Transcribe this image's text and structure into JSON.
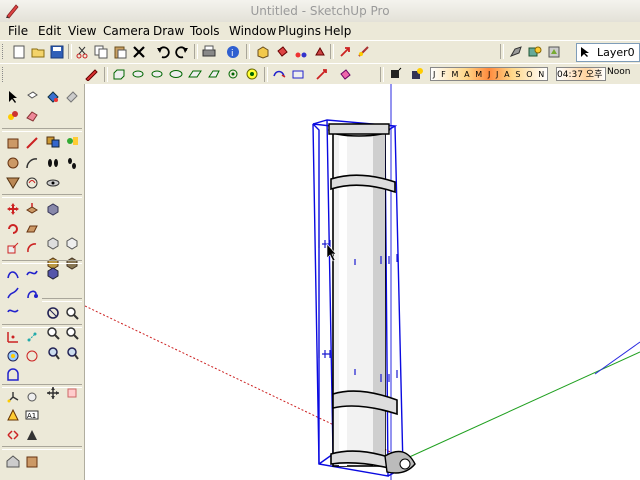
{
  "window": {
    "title": "Untitled - SketchUp Pro"
  },
  "menu": [
    "File",
    "Edit",
    "View",
    "Camera",
    "Draw",
    "Tools",
    "Window",
    "Plugins",
    "Help"
  ],
  "layers": {
    "current": "Layer0"
  },
  "shadows": {
    "months": "J F M A M J J A S O N D",
    "time": "04:37 오후",
    "noon": "Noon"
  },
  "toolbar1": [
    "new-icon",
    "open-icon",
    "save-icon",
    "cut-icon",
    "copy-icon",
    "paste-icon",
    "erase-icon",
    "undo-icon",
    "redo-icon",
    "print-icon",
    "model-info-icon",
    "make-component-icon",
    "paint-bucket-icon",
    "scissors-icon",
    "move-icon",
    "rotate-icon",
    "tape-measure-icon",
    "layer-manager-icon",
    "component-icon"
  ],
  "toolbar2": [
    "pencil-icon",
    "push-pull-icon",
    "cylinder-icon",
    "circle-icon",
    "polygon-icon",
    "offset-icon",
    "follow-me-icon",
    "scale-icon",
    "intersect-icon",
    "sandbox-icon",
    "paint-icon",
    "shadow-toggle-icon",
    "fog-icon"
  ],
  "left_tools": [
    "select-icon",
    "eraser-icon",
    "paint-bucket-icon",
    "component-icon",
    "rectangle-icon",
    "line-icon",
    "arc-icon",
    "freehand-icon",
    "circle-icon",
    "polygon-icon",
    "footprint-icon",
    "push-pull-icon",
    "move-icon",
    "rotate-icon",
    "follow-me-icon",
    "scale-icon",
    "offset-icon",
    "tape-measure-icon",
    "dimension-icon",
    "protractor-icon",
    "text-icon",
    "axes-icon",
    "3d-text-icon",
    "orbit-icon",
    "pan-icon",
    "zoom-icon",
    "zoom-window-icon",
    "zoom-extents-icon",
    "previous-view-icon",
    "next-view-icon",
    "position-camera-icon",
    "look-around-icon",
    "walk-icon",
    "section-plane-icon",
    "iso-view-icon",
    "top-view-icon",
    "front-view-icon",
    "right-view-icon",
    "back-view-icon",
    "left-view-icon",
    "xray-icon",
    "wireframe-icon",
    "hidden-line-icon",
    "shaded-icon",
    "textured-icon",
    "monochrome-icon",
    "sandbox-icon",
    "smoove-icon",
    "stamp-icon",
    "drape-icon",
    "add-detail-icon",
    "flip-edge-icon",
    "warehouse-icon",
    "share-icon"
  ]
}
